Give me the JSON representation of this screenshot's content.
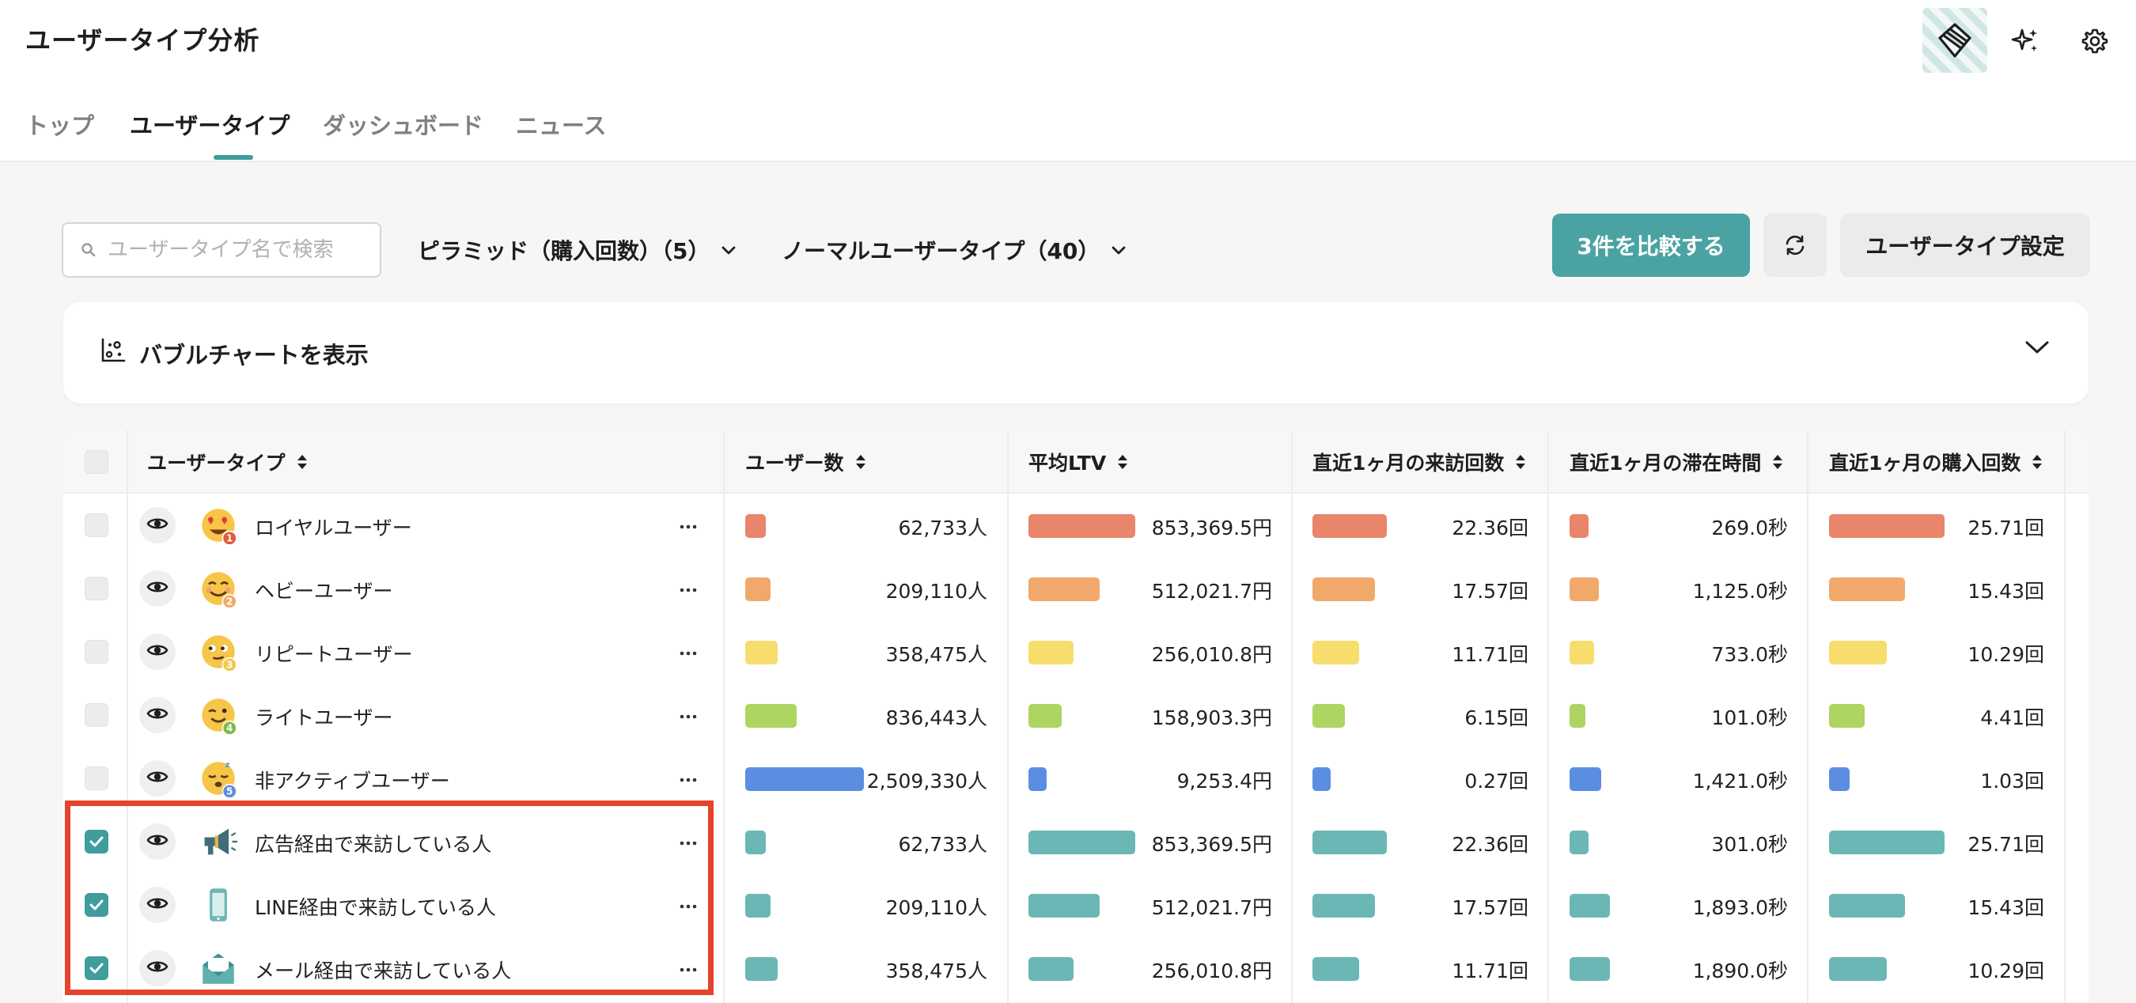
{
  "app": {
    "title": "ユーザータイプ分析"
  },
  "tabs": [
    {
      "label": "トップ"
    },
    {
      "label": "ユーザータイプ"
    },
    {
      "label": "ダッシュボード"
    },
    {
      "label": "ニュース"
    }
  ],
  "toolbar": {
    "search_placeholder": "ユーザータイプ名で検索",
    "pyramid_dropdown": "ピラミッド（購入回数）（5）",
    "normal_dropdown": "ノーマルユーザータイプ（40）",
    "compare_button": "3件を比較する",
    "settings_button": "ユーザータイプ設定"
  },
  "bubble_chart": {
    "label": "バブルチャートを表示"
  },
  "table": {
    "columns": [
      "ユーザータイプ",
      "ユーザー数",
      "平均LTV",
      "直近1ヶ月の来訪回数",
      "直近1ヶ月の滞在時間",
      "直近1ヶ月の購入回数"
    ],
    "rows": [
      {
        "name": "ロイヤルユーザー",
        "badge": "1",
        "avatar": "emoji-heart-eyes",
        "checked": false,
        "users": "62,733人",
        "ltv": "853,369.5円",
        "visits": "22.36回",
        "stay": "269.0秒",
        "purchases": "25.71回",
        "color": "#e8856a",
        "usersColor": "#e8856a",
        "stayColor": "#e8856a",
        "users_frac": 0.17,
        "ltv_frac": 0.93,
        "visits_frac": 0.85,
        "stay_frac": 0.25,
        "purch_frac": 0.94
      },
      {
        "name": "ヘビーユーザー",
        "badge": "2",
        "avatar": "emoji-smile",
        "checked": false,
        "users": "209,110人",
        "ltv": "512,021.7円",
        "visits": "17.57回",
        "stay": "1,125.0秒",
        "purchases": "15.43回",
        "color": "#f1a96b",
        "usersColor": "#f1a96b",
        "stayColor": "#f1a96b",
        "users_frac": 0.21,
        "ltv_frac": 0.62,
        "visits_frac": 0.72,
        "stay_frac": 0.39,
        "purch_frac": 0.62
      },
      {
        "name": "リピートユーザー",
        "badge": "3",
        "avatar": "emoji-look",
        "checked": false,
        "users": "358,475人",
        "ltv": "256,010.8円",
        "visits": "11.71回",
        "stay": "733.0秒",
        "purchases": "10.29回",
        "color": "#f7dd6b",
        "usersColor": "#f7dd6b",
        "stayColor": "#f7dd6b",
        "users_frac": 0.27,
        "ltv_frac": 0.39,
        "visits_frac": 0.54,
        "stay_frac": 0.32,
        "purch_frac": 0.47
      },
      {
        "name": "ライトユーザー",
        "badge": "4",
        "avatar": "emoji-wink",
        "checked": false,
        "users": "836,443人",
        "ltv": "158,903.3円",
        "visits": "6.15回",
        "stay": "101.0秒",
        "purchases": "4.41回",
        "color": "#aed462",
        "usersColor": "#aed462",
        "stayColor": "#aed462",
        "users_frac": 0.43,
        "ltv_frac": 0.29,
        "visits_frac": 0.37,
        "stay_frac": 0.21,
        "purch_frac": 0.29
      },
      {
        "name": "非アクティブユーザー",
        "badge": "5",
        "avatar": "emoji-sleepy",
        "checked": false,
        "users": "2,509,330人",
        "ltv": "9,253.4円",
        "visits": "0.27回",
        "stay": "1,421.0秒",
        "purchases": "1.03回",
        "color": "#5b8ee0",
        "usersColor": "#5b8ee0",
        "stayColor": "#5b8ee0",
        "users_frac": 1.0,
        "ltv_frac": 0.16,
        "visits_frac": 0.21,
        "stay_frac": 0.42,
        "purch_frac": 0.17
      },
      {
        "name": "広告経由で来訪している人",
        "badge": "",
        "avatar": "megaphone-icon",
        "checked": true,
        "users": "62,733人",
        "ltv": "853,369.5円",
        "visits": "22.36回",
        "stay": "301.0秒",
        "purchases": "25.71回",
        "color": "#6bb7b5",
        "usersColor": "#6bb7b5",
        "stayColor": "#6bb7b5",
        "users_frac": 0.17,
        "ltv_frac": 0.93,
        "visits_frac": 0.85,
        "stay_frac": 0.25,
        "purch_frac": 0.94
      },
      {
        "name": "LINE経由で来訪している人",
        "badge": "",
        "avatar": "smartphone-icon",
        "checked": true,
        "users": "209,110人",
        "ltv": "512,021.7円",
        "visits": "17.57回",
        "stay": "1,893.0秒",
        "purchases": "15.43回",
        "color": "#6bb7b5",
        "usersColor": "#6bb7b5",
        "stayColor": "#6bb7b5",
        "users_frac": 0.21,
        "ltv_frac": 0.62,
        "visits_frac": 0.72,
        "stay_frac": 0.53,
        "purch_frac": 0.62
      },
      {
        "name": "メール経由で来訪している人",
        "badge": "",
        "avatar": "envelope-icon",
        "checked": true,
        "users": "358,475人",
        "ltv": "256,010.8円",
        "visits": "11.71回",
        "stay": "1,890.0秒",
        "purchases": "10.29回",
        "color": "#6bb7b5",
        "usersColor": "#6bb7b5",
        "stayColor": "#6bb7b5",
        "users_frac": 0.27,
        "ltv_frac": 0.39,
        "visits_frac": 0.54,
        "stay_frac": 0.53,
        "purch_frac": 0.47
      }
    ]
  },
  "colors": {
    "accent": "#3f9d9c",
    "highlight": "#e5432b"
  }
}
